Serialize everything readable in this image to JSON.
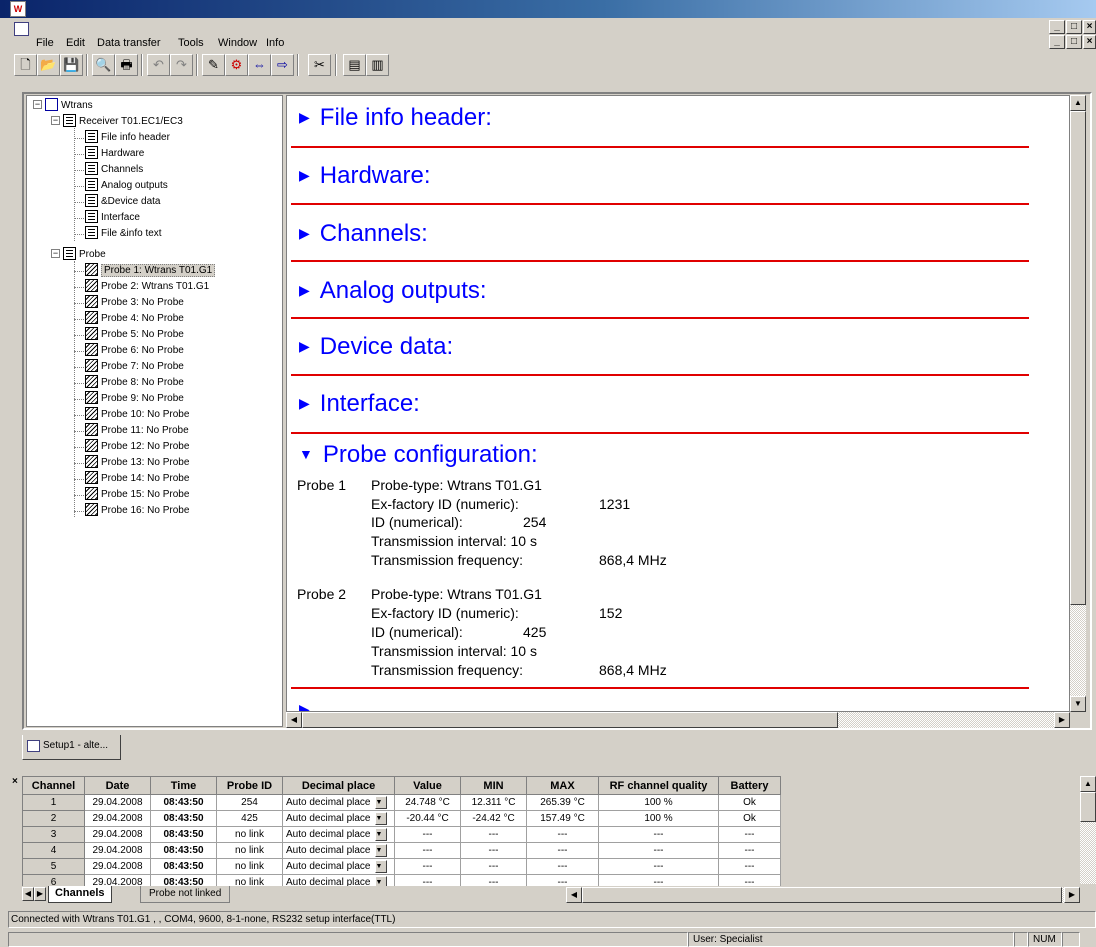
{
  "window": {
    "title": "",
    "controls": {
      "minimize": "_",
      "restore": "□",
      "close": "×"
    }
  },
  "menu": {
    "items": [
      "File",
      "Edit",
      "Data transfer",
      "Tools",
      "Window",
      "Info"
    ]
  },
  "toolbar": {
    "buttons": [
      "new-icon",
      "open-icon",
      "save-icon",
      "print-preview-icon",
      "print-icon",
      "undo-icon",
      "redo-icon",
      "tool-a-icon",
      "tool-b-icon",
      "tool-c-icon",
      "tool-d-icon",
      "tool-e-icon",
      "layout-a-icon",
      "layout-b-icon"
    ]
  },
  "tree": {
    "root": "Wtrans",
    "receiver": "Receiver T01.EC1/EC3",
    "receiver_items": [
      "File info header",
      "Hardware",
      "Channels",
      "Analog outputs",
      "&Device data",
      "Interface",
      "File &info text"
    ],
    "probe": "Probe",
    "probe_items": [
      "Probe 1: Wtrans T01.G1",
      "Probe 2: Wtrans T01.G1",
      "Probe 3:  No Probe",
      "Probe 4:  No Probe",
      "Probe 5:  No Probe",
      "Probe 6:  No Probe",
      "Probe 7:  No Probe",
      "Probe 8:  No Probe",
      "Probe 9:  No Probe",
      "Probe 10:  No Probe",
      "Probe 11:  No Probe",
      "Probe 12:  No Probe",
      "Probe 13:  No Probe",
      "Probe 14:  No Probe",
      "Probe 15:  No Probe",
      "Probe 16:  No Probe"
    ]
  },
  "content": {
    "sections": [
      "File info header:",
      "Hardware:",
      "Channels:",
      "Analog outputs:",
      "Device data:",
      "Interface:",
      "Probe configuration:"
    ],
    "probes": [
      {
        "label": "Probe 1",
        "type_line": "Probe-type: Wtrans T01.G1",
        "ex_factory_label": "Ex-factory ID (numeric):",
        "ex_factory_value": "1231",
        "id_label": "ID (numerical):",
        "id_value": "254",
        "interval": "Transmission interval: 10 s",
        "freq_label": "Transmission frequency:",
        "freq_value": "868,4 MHz"
      },
      {
        "label": "Probe 2",
        "type_line": "Probe-type: Wtrans T01.G1",
        "ex_factory_label": "Ex-factory ID (numeric):",
        "ex_factory_value": "152",
        "id_label": "ID (numerical):",
        "id_value": "425",
        "interval": "Transmission interval: 10 s",
        "freq_label": "Transmission frequency:",
        "freq_value": "868,4 MHz"
      }
    ]
  },
  "doc_tab": {
    "label": "Setup1 - alte..."
  },
  "grid": {
    "columns": [
      "Channel",
      "Date",
      "Time",
      "Probe ID",
      "Decimal place",
      "Value",
      "MIN",
      "MAX",
      "RF channel quality",
      "Battery"
    ],
    "rows": [
      [
        "1",
        "29.04.2008",
        "08:43:50",
        "254",
        "Auto decimal place",
        "24.748 °C",
        "12.311 °C",
        "265.39 °C",
        "100 %",
        "Ok"
      ],
      [
        "2",
        "29.04.2008",
        "08:43:50",
        "425",
        "Auto decimal place",
        "-20.44 °C",
        "-24.42 °C",
        "157.49 °C",
        "100 %",
        "Ok"
      ],
      [
        "3",
        "29.04.2008",
        "08:43:50",
        "no link",
        "Auto decimal place",
        "---",
        "---",
        "---",
        "---",
        "---"
      ],
      [
        "4",
        "29.04.2008",
        "08:43:50",
        "no link",
        "Auto decimal place",
        "---",
        "---",
        "---",
        "---",
        "---"
      ],
      [
        "5",
        "29.04.2008",
        "08:43:50",
        "no link",
        "Auto decimal place",
        "---",
        "---",
        "---",
        "---",
        "---"
      ],
      [
        "6",
        "29.04.2008",
        "08:43:50",
        "no link",
        "Auto decimal place",
        "---",
        "---",
        "---",
        "---",
        "---"
      ]
    ],
    "sheet_tabs": [
      "Channels",
      "Probe not linked"
    ]
  },
  "status": {
    "connection": "Connected with Wtrans T01.G1 ,  , COM4, 9600, 8-1-none, RS232 setup interface(TTL)",
    "user": "User: Specialist",
    "num": "NUM"
  }
}
